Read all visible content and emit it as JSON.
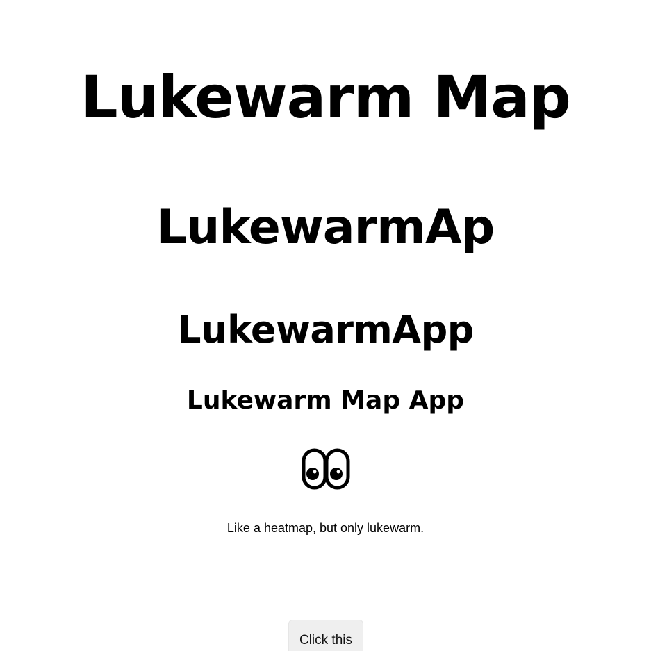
{
  "headings": {
    "h1": "Lukewarm Map",
    "h2": "LukewarmAp",
    "h3": "LukewarmApp",
    "h4": "Lukewarm Map App"
  },
  "emoji": {
    "icon": "eyes-icon"
  },
  "tagline": "Like a heatmap, but only lukewarm.",
  "button": {
    "label": "Click this",
    "background": "#efefef"
  },
  "colors": {
    "background": "#ffffff",
    "text": "#000000"
  }
}
